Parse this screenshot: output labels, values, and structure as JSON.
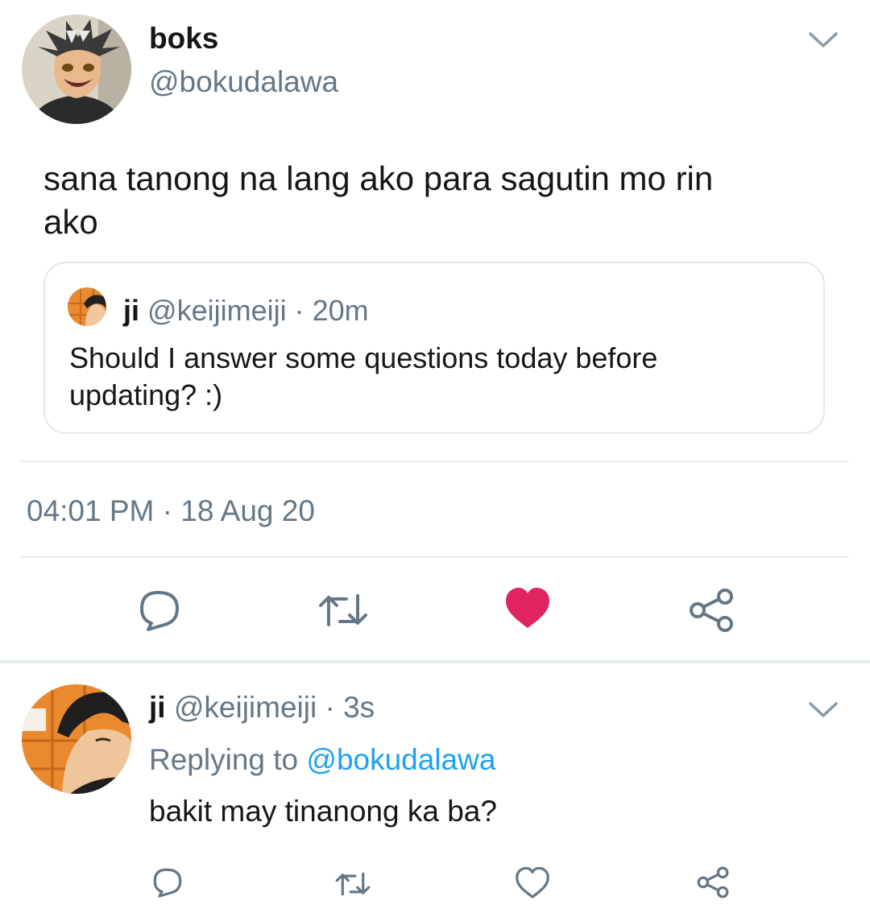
{
  "main_tweet": {
    "display_name": "boks",
    "handle": "@bokudalawa",
    "text_line1": "sana tanong na lang ako para sagutin mo rin",
    "text_line2": "ako",
    "quoted": {
      "display_name": "ji",
      "handle": "@keijimeiji",
      "time": "· 20m",
      "text_line1": "Should I answer some questions today before",
      "text_line2": "updating? :)"
    },
    "timestamp": "04:01 PM · 18 Aug 20",
    "liked": true
  },
  "reply": {
    "display_name": "ji",
    "handle": "@keijimeiji",
    "time": "· 3s",
    "replying_prefix": "Replying to",
    "replying_handle": "@bokudalawa",
    "text": "bakit may tinanong ka ba?",
    "liked": false
  },
  "colors": {
    "like_active": "#e0245e",
    "icon_gray": "#657786",
    "link": "#1da1f2"
  },
  "icons": [
    "chevron-down-icon",
    "reply-icon",
    "retweet-icon",
    "heart-icon",
    "share-icon"
  ]
}
